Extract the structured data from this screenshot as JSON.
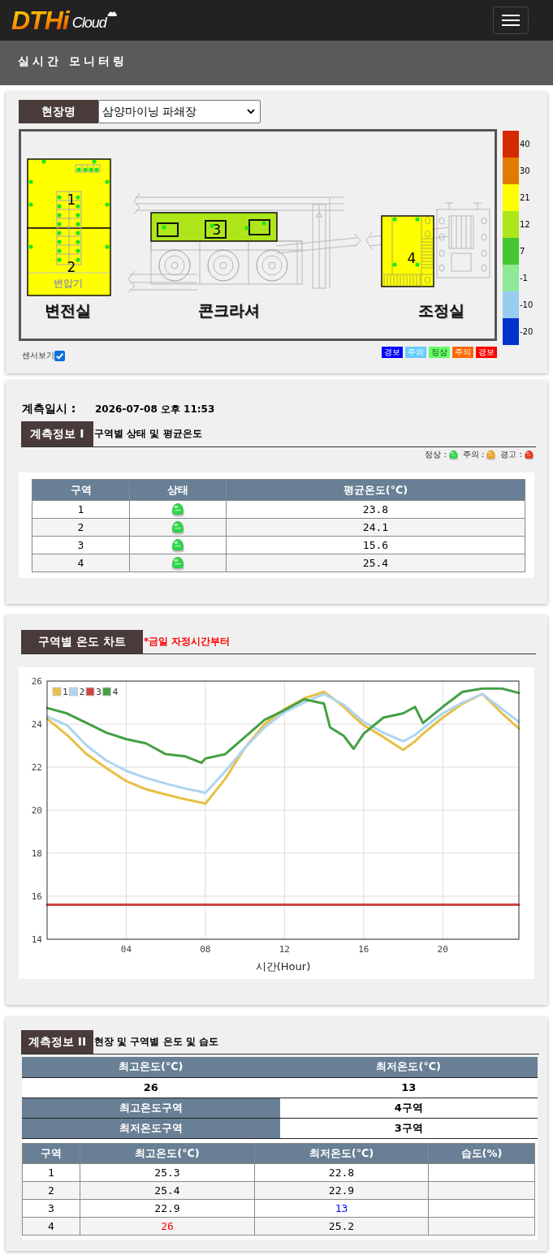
{
  "header": {
    "logo_main": "DTHi",
    "logo_sub": "Cloud"
  },
  "page_title": "실시간 모니터링",
  "site": {
    "label": "현장명",
    "value": "삼양마이닝 파쇄장"
  },
  "layout_map": {
    "zones": [
      {
        "number": "1",
        "color": "#ffff00"
      },
      {
        "number": "2",
        "color": "#ffff00"
      },
      {
        "number": "3",
        "color": "#aee61a"
      },
      {
        "number": "4",
        "color": "#ffff00"
      }
    ],
    "rooms": [
      "변전실",
      "콘크라셔",
      "조정실"
    ],
    "equipment_label": "변압기",
    "show_sensors": true,
    "show_sensors_label": "센서보기"
  },
  "color_scale": [
    {
      "label": "40",
      "color": "#d42a00"
    },
    {
      "label": "30",
      "color": "#e07b00"
    },
    {
      "label": "21",
      "color": "#ffff00"
    },
    {
      "label": "12",
      "color": "#aee61a"
    },
    {
      "label": "7",
      "color": "#44c732"
    },
    {
      "label": "-1",
      "color": "#8ee896"
    },
    {
      "label": "-10",
      "color": "#99ccf0"
    },
    {
      "label": "-20",
      "color": "#0033cc"
    }
  ],
  "alert_legend": [
    {
      "label": "경보",
      "color": "#0000ff"
    },
    {
      "label": "주의",
      "color": "#66ccff"
    },
    {
      "label": "정상",
      "color": "#66ff66"
    },
    {
      "label": "주의",
      "color": "#ff6600"
    },
    {
      "label": "경보",
      "color": "#ff0000"
    }
  ],
  "measurement": {
    "label": "계측일시 :",
    "value": "2026-07-08 오후 11:53"
  },
  "info1": {
    "tab": "계측정보 I",
    "subtitle": "구역별 상태 및 평균온도",
    "legend": [
      {
        "label": "정상 :",
        "color": "#2ed84a"
      },
      {
        "label": "주의 :",
        "color": "#f2a31b"
      },
      {
        "label": "경고 :",
        "color": "#e8361f"
      }
    ],
    "columns": [
      "구역",
      "상태",
      "평균온도(℃)"
    ],
    "rows": [
      {
        "zone": "1",
        "color": "#2ed84a",
        "average": "23.8"
      },
      {
        "zone": "2",
        "color": "#2ed84a",
        "average": "24.1"
      },
      {
        "zone": "3",
        "color": "#2ed84a",
        "average": "15.6"
      },
      {
        "zone": "4",
        "color": "#2ed84a",
        "average": "25.4"
      }
    ]
  },
  "chart_section": {
    "tab": "구역별 온도 차트",
    "note": "*금일 자정시간부터",
    "chart_data": {
      "type": "line",
      "xlabel": "시간(Hour)",
      "grid": true,
      "legend": "upper left",
      "x": [
        0,
        1,
        2,
        3,
        4,
        5,
        6,
        7,
        7.8,
        8,
        9,
        10,
        11,
        12,
        13,
        14,
        14.3,
        15,
        15.5,
        16,
        17,
        18,
        18.6,
        19,
        20,
        21,
        22,
        23,
        23.85
      ],
      "series": [
        {
          "name": "1",
          "color": "#e8bf45",
          "values": [
            24.25,
            23.5,
            22.6,
            21.95,
            21.35,
            20.97,
            20.73,
            20.5,
            20.35,
            20.3,
            21.45,
            22.9,
            24.0,
            24.7,
            25.2,
            25.5,
            25.3,
            24.8,
            24.35,
            23.95,
            23.4,
            22.8,
            23.2,
            23.55,
            24.3,
            24.95,
            25.4,
            24.5,
            23.8
          ]
        },
        {
          "name": "2",
          "color": "#aed4f2",
          "values": [
            24.35,
            23.95,
            23.0,
            22.3,
            21.83,
            21.5,
            21.23,
            21.0,
            20.85,
            20.8,
            21.8,
            22.9,
            23.85,
            24.55,
            25.0,
            25.4,
            25.25,
            24.9,
            24.5,
            24.1,
            23.6,
            23.2,
            23.5,
            23.8,
            24.5,
            25.0,
            25.4,
            24.7,
            24.1
          ]
        },
        {
          "name": "3",
          "color": "#cc4444",
          "values": [
            15.6,
            15.6,
            15.6,
            15.6,
            15.6,
            15.6,
            15.6,
            15.6,
            15.6,
            15.6,
            15.6,
            15.6,
            15.6,
            15.6,
            15.6,
            15.6,
            15.6,
            15.6,
            15.6,
            15.6,
            15.6,
            15.6,
            15.6,
            15.6,
            15.6,
            15.6,
            15.6,
            15.6,
            15.6
          ]
        },
        {
          "name": "4",
          "color": "#44a044",
          "values": [
            24.75,
            24.5,
            24.05,
            23.6,
            23.3,
            23.1,
            22.6,
            22.5,
            22.2,
            22.4,
            22.6,
            23.4,
            24.2,
            24.65,
            25.15,
            24.95,
            23.85,
            23.45,
            22.85,
            23.55,
            24.3,
            24.5,
            24.8,
            24.05,
            24.8,
            25.5,
            25.65,
            25.65,
            25.45
          ]
        }
      ],
      "xlim": [
        0,
        23.85
      ],
      "ylim": [
        14,
        26
      ],
      "xticks": [
        {
          "value": 4,
          "label": "04"
        },
        {
          "value": 8,
          "label": "08"
        },
        {
          "value": 12,
          "label": "12"
        },
        {
          "value": 16,
          "label": "16"
        },
        {
          "value": 20,
          "label": "20"
        }
      ],
      "yticks": [
        14,
        16,
        18,
        20,
        22,
        24,
        26
      ]
    }
  },
  "info2": {
    "tab": "계측정보 II",
    "subtitle": "현장 및 구역별 온도 및 습도",
    "summary": {
      "max_label": "최고온도(℃)",
      "min_label": "최저온도(℃)",
      "max_value": "26",
      "min_value": "13",
      "max_zone_label": "최고온도구역",
      "max_zone": "4구역",
      "min_zone_label": "최저온도구역",
      "min_zone": "3구역"
    },
    "columns": [
      "구역",
      "최고온도(℃)",
      "최저온도(℃)",
      "습도(%)"
    ],
    "rows": [
      {
        "zone": "1",
        "max": "25.3",
        "min": "22.8",
        "highest": false,
        "lowest": false
      },
      {
        "zone": "2",
        "max": "25.4",
        "min": "22.9",
        "highest": false,
        "lowest": false
      },
      {
        "zone": "3",
        "max": "22.9",
        "min": "13",
        "highest": false,
        "lowest": true
      },
      {
        "zone": "4",
        "max": "26",
        "min": "25.2",
        "highest": true,
        "lowest": false
      }
    ]
  }
}
